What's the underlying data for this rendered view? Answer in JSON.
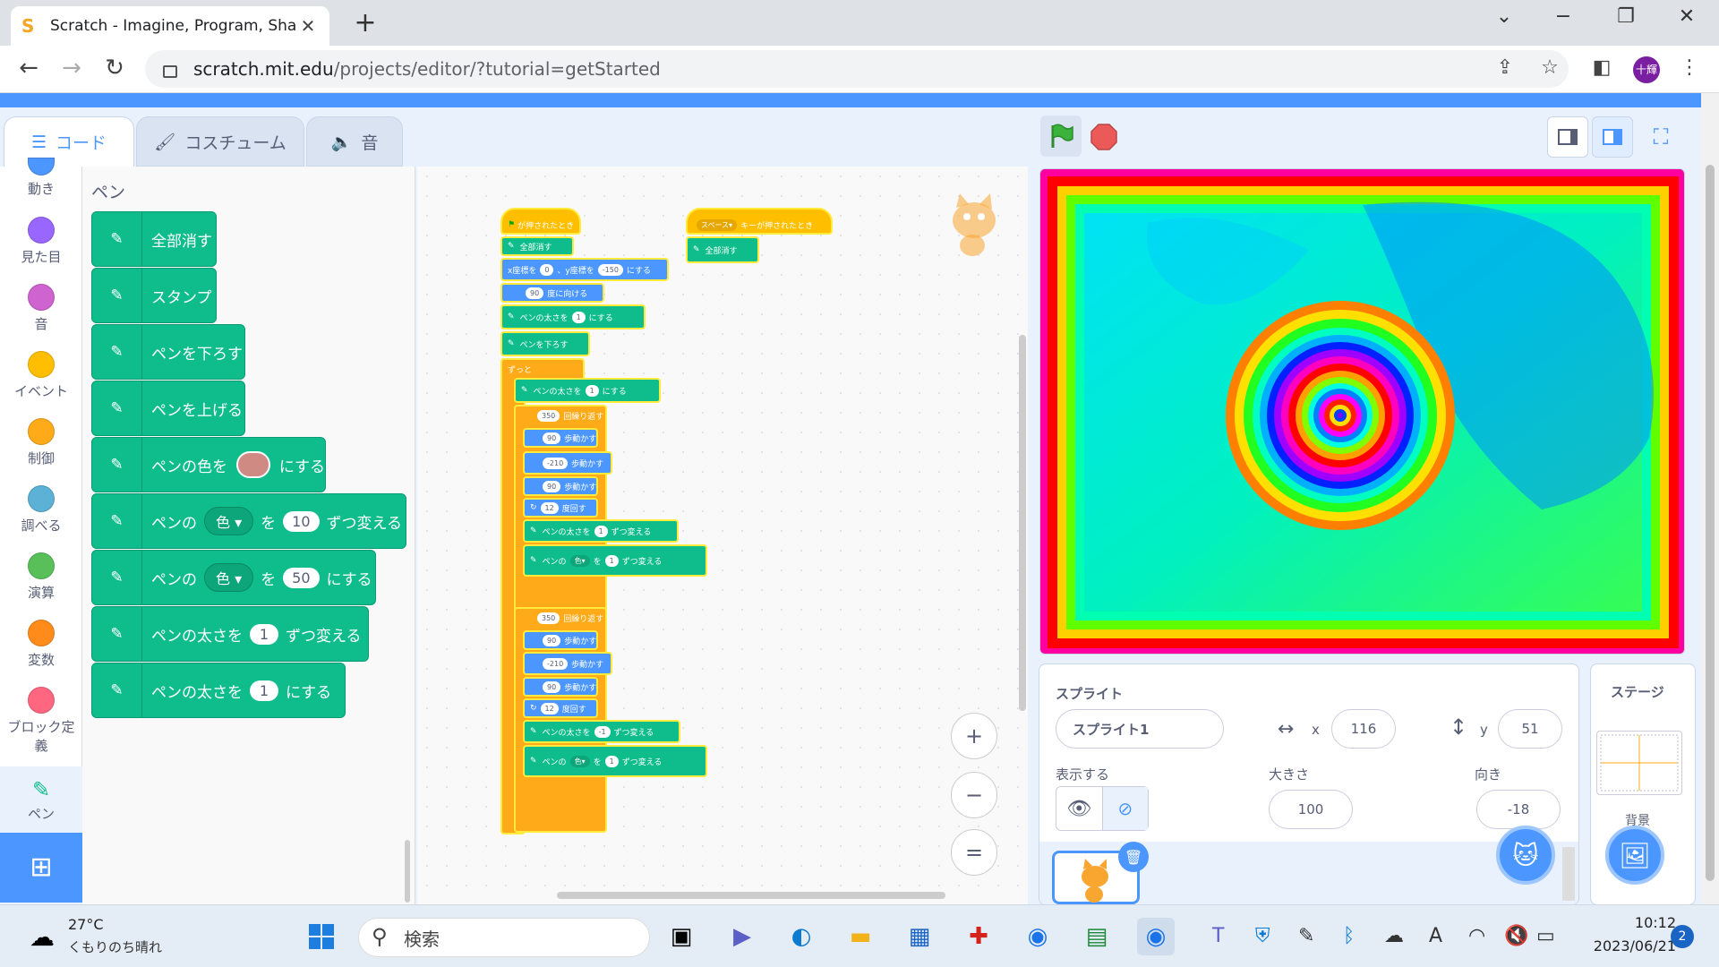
{
  "browser": {
    "tab_title": "Scratch - Imagine, Program, Shar",
    "new_tab": "+",
    "url_host": "scratch.mit.edu",
    "url_path": "/projects/editor/?tutorial=getStarted",
    "profile_label": "十輝"
  },
  "editor_tabs": [
    {
      "label": "コード",
      "icon": "code-icon"
    },
    {
      "label": "コスチューム",
      "icon": "brush-icon"
    },
    {
      "label": "音",
      "icon": "speaker-icon"
    }
  ],
  "categories": [
    {
      "label": "動き",
      "color": "#4c97ff"
    },
    {
      "label": "見た目",
      "color": "#9966ff"
    },
    {
      "label": "音",
      "color": "#cf63cf"
    },
    {
      "label": "イベント",
      "color": "#ffbf00"
    },
    {
      "label": "制御",
      "color": "#ffab19"
    },
    {
      "label": "調べる",
      "color": "#5cb1d6"
    },
    {
      "label": "演算",
      "color": "#59c059"
    },
    {
      "label": "変数",
      "color": "#ff8c1a"
    },
    {
      "label": "ブロック定義",
      "color": "#ff6680"
    },
    {
      "label": "ペン",
      "color": "#0fbd8c"
    }
  ],
  "palette": {
    "title": "ペン",
    "blocks": [
      {
        "text": "全部消す"
      },
      {
        "text": "スタンプ"
      },
      {
        "text": "ペンを下ろす"
      },
      {
        "text": "ペンを上げる"
      },
      {
        "pre": "ペンの色を",
        "post": "にする",
        "swatch": "#d08a84"
      },
      {
        "pre": "ペンの",
        "drop": "色",
        "mid": "を",
        "num": "10",
        "post": "ずつ変える"
      },
      {
        "pre": "ペンの",
        "drop": "色",
        "mid": "を",
        "num": "50",
        "post": "にする"
      },
      {
        "pre": "ペンの太さを",
        "num": "1",
        "post": "ずつ変える"
      },
      {
        "pre": "ペンの太さを",
        "num": "1",
        "post": "にする"
      }
    ]
  },
  "script": {
    "hat1": "が押されたとき",
    "hat2_key": "スペース",
    "hat2_text": "キーが押されたとき",
    "clear1": "全部消す",
    "clear2": "全部消す",
    "goto_x_label": "x座標を",
    "goto_x": "0",
    "goto_y_label": "、y座標を",
    "goto_y": "-150",
    "goto_post": "にする",
    "point_val": "90",
    "point_text": "度に向ける",
    "size1_pre": "ペンの太さを",
    "size1_val": "1",
    "size1_post": "にする",
    "pendown": "ペンを下ろす",
    "forever": "ずっと",
    "size2_pre": "ペンの太さを",
    "size2_val": "1",
    "size2_post": "にする",
    "rep1_val": "350",
    "rep1_text": "回繰り返す",
    "mv1": "90",
    "mv2": "-210",
    "mv3": "90",
    "move_text": "歩動かす",
    "turn1": "12",
    "turn_text": "度回す",
    "chsize1_pre": "ペンの太さを",
    "chsize1_val": "1",
    "chsize1_post": "ずつ変える",
    "chcol1_pre": "ペンの",
    "chcol1_drop": "色",
    "chcol1_mid": "を",
    "chcol1_val": "1",
    "chcol1_post": "ずつ変える",
    "rep2_val": "350",
    "mv4": "90",
    "mv5": "-210",
    "mv6": "90",
    "turn2": "12",
    "chsize2_val": "-1",
    "chcol2_val": "1"
  },
  "zoom": {
    "in": "+",
    "out": "−",
    "reset": "="
  },
  "sprite_info": {
    "label": "スプライト",
    "name": "スプライト1",
    "x_label": "x",
    "x": "116",
    "y_label": "y",
    "y": "51",
    "show_label": "表示する",
    "size_label": "大きさ",
    "size": "100",
    "dir_label": "向き",
    "direction": "-18"
  },
  "stage_panel": {
    "label": "ステージ",
    "backdrop_label": "背景"
  },
  "taskbar": {
    "temp": "27°C",
    "weather": "くもりのち晴れ",
    "search": "検索",
    "time": "10:12",
    "date": "2023/06/21",
    "notif": "2"
  }
}
